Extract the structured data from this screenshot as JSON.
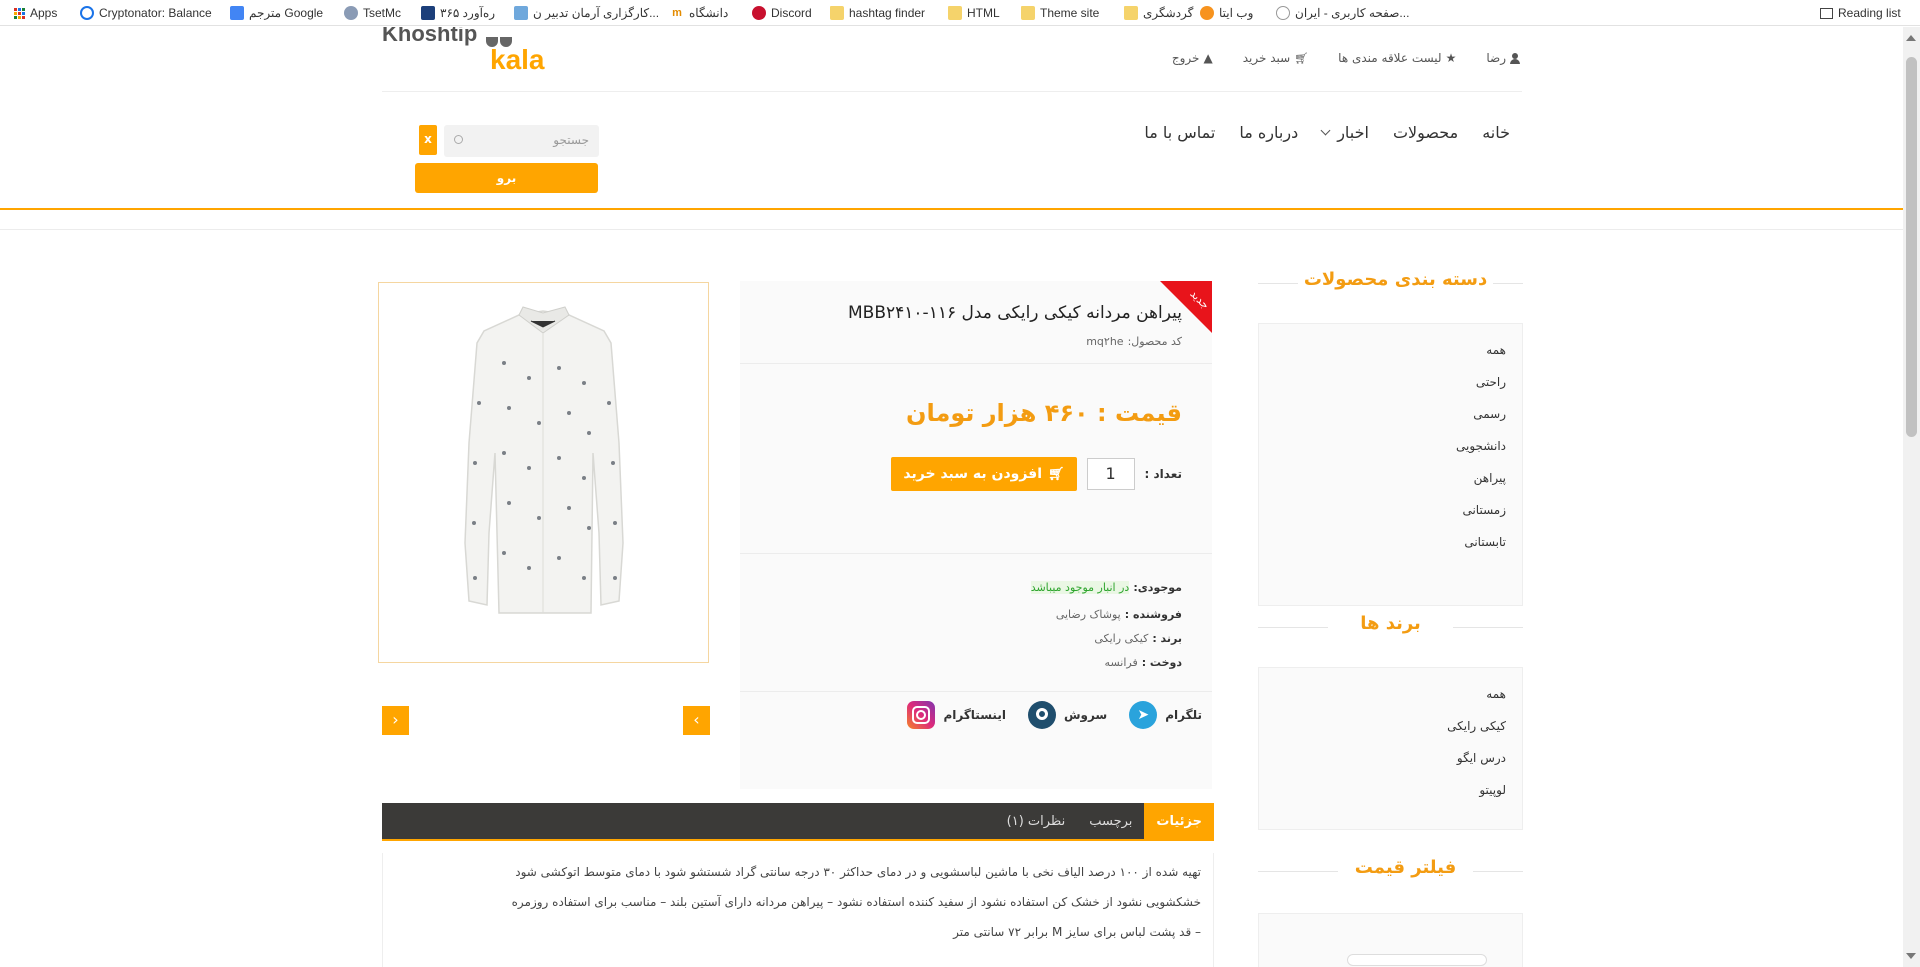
{
  "bookmarks": {
    "apps": "Apps",
    "items": [
      "Cryptonator: Balance",
      "مترجم Google",
      "TsetMc",
      "ره‌آورد ۳۶۵",
      "کارگزاری آرمان تدبیر ن...",
      "دانشگاه",
      "Discord",
      "hashtag finder",
      "HTML",
      "Theme site",
      "گردشگری",
      "وب ایتا",
      "صفحه کاربری - ایران..."
    ],
    "reading_list": "Reading list"
  },
  "header": {
    "logo_top": "Khoshtip",
    "logo_bottom": "kala",
    "user": "رضا",
    "wishlist": "لیست علاقه مندی ها",
    "cart": "سبد خرید",
    "logout": "خروج"
  },
  "nav": {
    "items": [
      "خانه",
      "محصولات",
      "اخبار",
      "درباره ما",
      "تماس با ما"
    ]
  },
  "search": {
    "placeholder": "جستجو",
    "clear": "x",
    "go": "برو"
  },
  "sidebar": {
    "categories_title": "دسته بندی محصولات",
    "categories": [
      "همه",
      "راحتی",
      "رسمی",
      "دانشجویی",
      "پیراهن",
      "زمستانی",
      "تابستانی"
    ],
    "brands_title": "برند ها",
    "brands": [
      "همه",
      "کیکی رایکی",
      "درس ایگو",
      "لوپیتو"
    ],
    "price_filter_title": "فیلتر قیمت"
  },
  "product": {
    "badge": "جدید",
    "title": "پیراهن مردانه کیکی رایکی مدل ۱۱۶-MBB۲۴۱۰",
    "code_label": "کد محصول:",
    "code_value": "mq۲he",
    "price": "قیمت : ۴۶۰ هزار تومان",
    "qty_label": "تعداد :",
    "qty_value": "1",
    "add_to_cart": "افزودن به سبد خرید",
    "stock_label": "موجودی:",
    "stock_value": "در انبار موجود میباشد",
    "seller_label": "فروشنده :",
    "seller_value": "پوشاک رضایی",
    "brand_label": "برند :",
    "brand_value": "کیکی رایکی",
    "made_label": "دوخت :",
    "made_value": "فرانسه",
    "share": {
      "telegram": "تلگرام",
      "soroush": "سروش",
      "instagram": "اینستاگرام"
    }
  },
  "tabs": {
    "items": [
      "جزئیات",
      "برچسب",
      "نظرات (۱)"
    ],
    "active": "جزئیات"
  },
  "description": {
    "line1": "تهیه شده از ۱۰۰ درصد الیاف نخی با ماشین لباسشویی و در دمای حداکثر ۳۰ درجه سانتی گراد شستشو شود با دمای متوسط اتوکشی شود",
    "line2": "خشکشویی نشود از خشک کن استفاده نشود از سفید کننده استفاده نشود – پیراهن مردانه دارای آستین بلند – مناسب برای استفاده روزمره",
    "line3": "– قد پشت لباس برای سایز M برابر ۷۲ سانتی متر"
  },
  "colors": {
    "accent": "#ffa500",
    "accent_text": "#f39c12",
    "badge": "#e8141b",
    "tabs_bg": "#3b3a38",
    "in_stock": "#2ea52e"
  }
}
